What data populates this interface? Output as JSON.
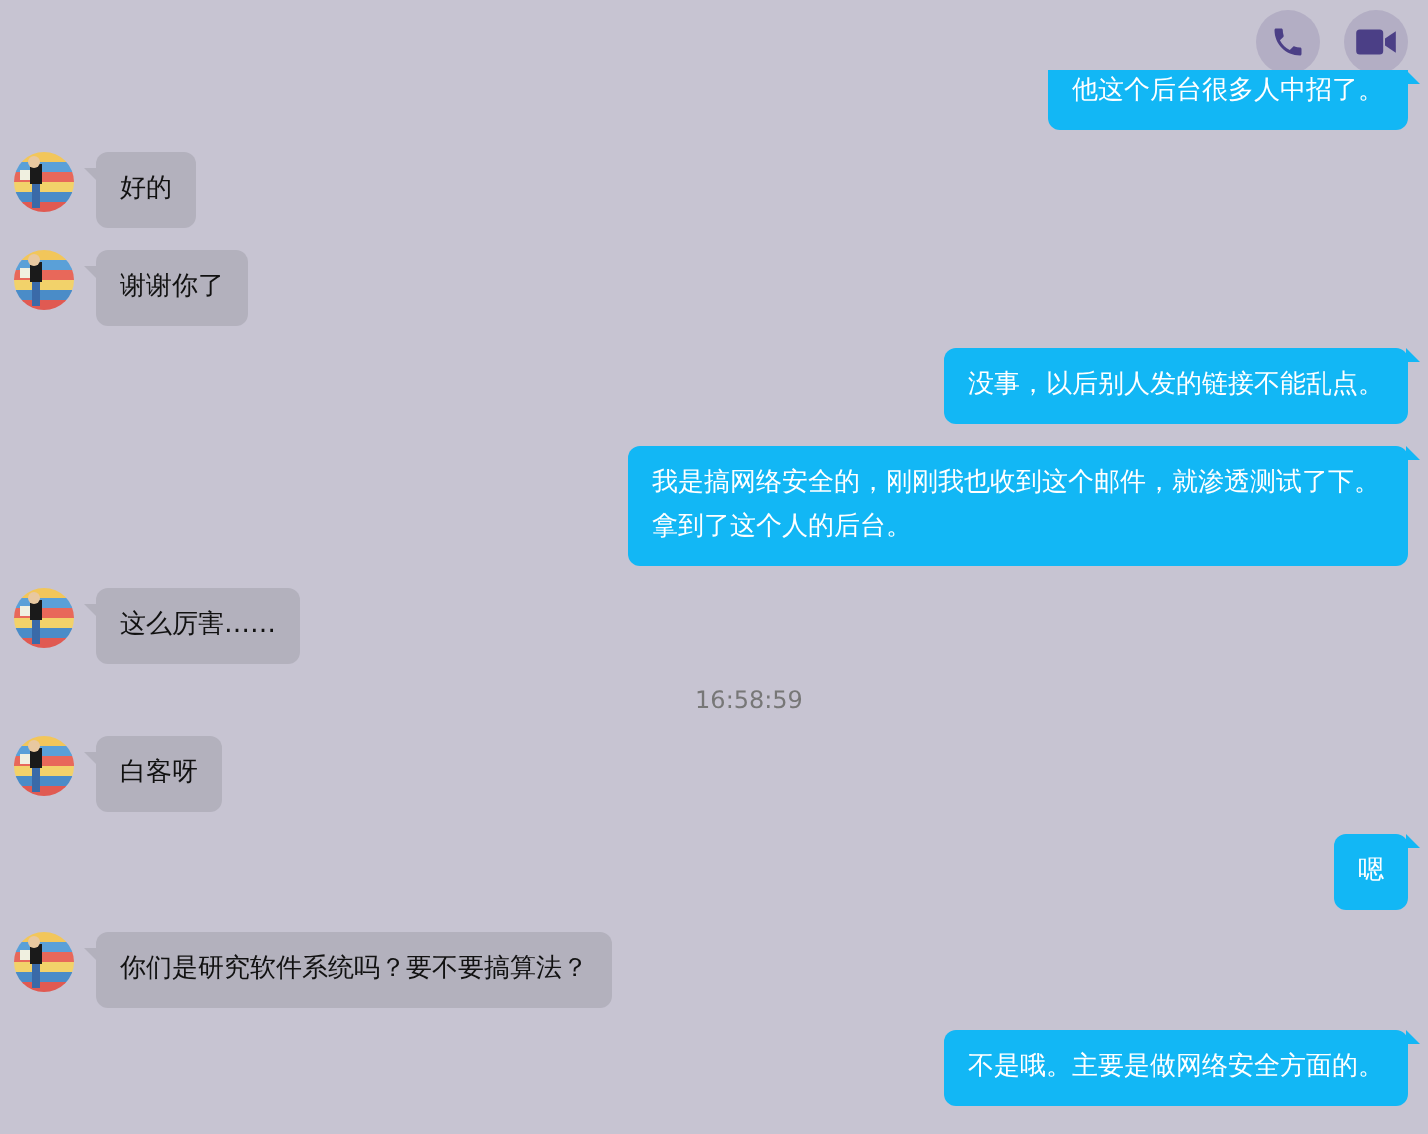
{
  "messages": [
    {
      "kind": "sent",
      "text": "他这个后台很多人中招了。"
    },
    {
      "kind": "received",
      "text": "好的"
    },
    {
      "kind": "received",
      "text": "谢谢你了"
    },
    {
      "kind": "sent",
      "text": "没事，以后别人发的链接不能乱点。"
    },
    {
      "kind": "sent",
      "text": "我是搞网络安全的，刚刚我也收到这个邮件，就渗透测试了下。拿到了这个人的后台。"
    },
    {
      "kind": "received",
      "text": "这么厉害……"
    },
    {
      "kind": "time",
      "text": "16:58:59"
    },
    {
      "kind": "received",
      "text": "白客呀"
    },
    {
      "kind": "sent",
      "text": "嗯"
    },
    {
      "kind": "received",
      "text": "你们是研究软件系统吗？要不要搞算法？"
    },
    {
      "kind": "sent",
      "text": "不是哦。主要是做网络安全方面的。"
    }
  ]
}
